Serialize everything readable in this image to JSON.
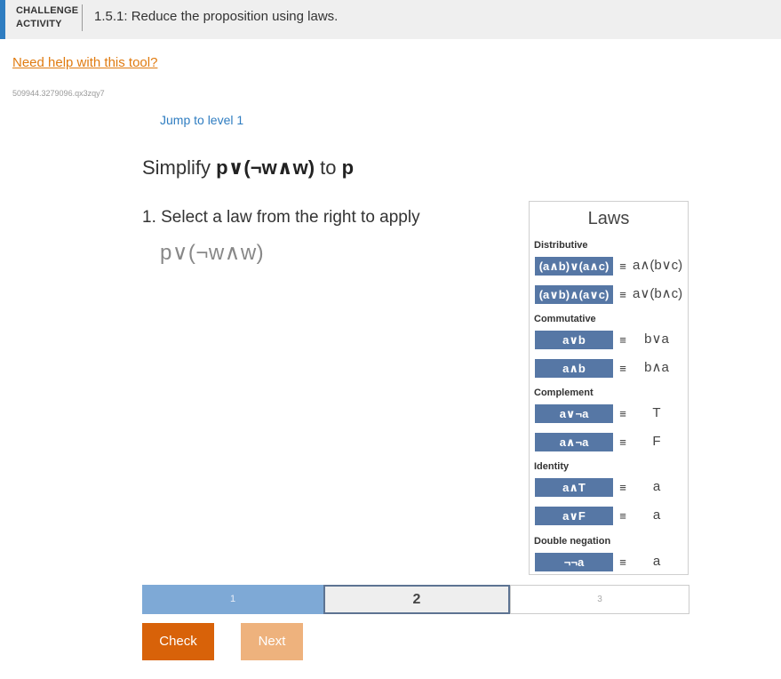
{
  "header": {
    "label_line1": "CHALLENGE",
    "label_line2": "ACTIVITY",
    "title": "1.5.1: Reduce the proposition using laws."
  },
  "help_link": "Need help with this tool?",
  "activity_id": "509944.3279096.qx3zqy7",
  "jump_link": "Jump to level 1",
  "prompt": {
    "prefix": "Simplify ",
    "from_expr": "p∨(¬w∧w)",
    "middle": " to ",
    "to_expr": "p"
  },
  "step": {
    "title": "1. Select a law from the right to apply",
    "expression": "p∨(¬w∧w)"
  },
  "laws": {
    "title": "Laws",
    "equiv_symbol": "≡",
    "categories": [
      {
        "name": "Distributive",
        "rules": [
          {
            "left": "(a∧b)∨(a∧c)",
            "right": "a∧(b∨c)"
          },
          {
            "left": "(a∨b)∧(a∨c)",
            "right": "a∨(b∧c)"
          }
        ]
      },
      {
        "name": "Commutative",
        "rules": [
          {
            "left": "a∨b",
            "right": "b∨a"
          },
          {
            "left": "a∧b",
            "right": "b∧a"
          }
        ]
      },
      {
        "name": "Complement",
        "rules": [
          {
            "left": "a∨¬a",
            "right": "T"
          },
          {
            "left": "a∧¬a",
            "right": "F"
          }
        ]
      },
      {
        "name": "Identity",
        "rules": [
          {
            "left": "a∧T",
            "right": "a"
          },
          {
            "left": "a∨F",
            "right": "a"
          }
        ]
      },
      {
        "name": "Double negation",
        "rules": [
          {
            "left": "¬¬a",
            "right": "a"
          }
        ]
      }
    ]
  },
  "progress": {
    "levels": [
      "1",
      "2",
      "3"
    ],
    "current": 2,
    "completed_fraction": 0.333
  },
  "buttons": {
    "check": "Check",
    "next": "Next"
  },
  "colors": {
    "accent": "#2f7dc1",
    "link": "#e07b10",
    "law_button": "#5677a5",
    "check_button": "#d86209",
    "next_button": "#eeb27d"
  }
}
